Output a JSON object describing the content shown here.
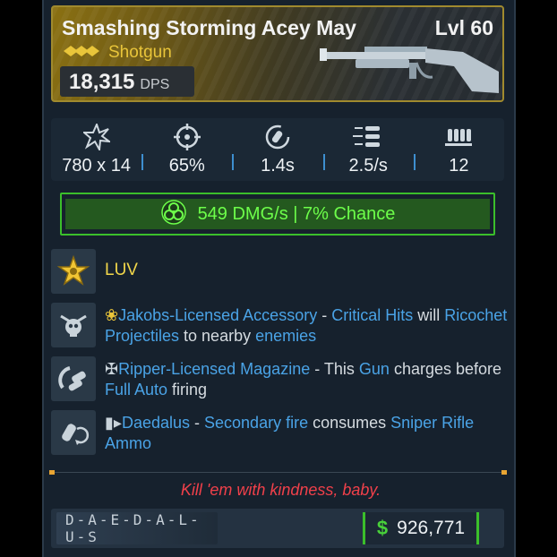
{
  "item": {
    "name": "Smashing Storming Acey May",
    "level": "Lvl 60",
    "type": "Shotgun",
    "dps": "18,315",
    "dps_unit": "DPS",
    "rarity_color": "#e9c53a"
  },
  "stats": [
    {
      "icon": "damage-burst-icon",
      "value": "780 x 14"
    },
    {
      "icon": "accuracy-crosshair-icon",
      "value": "65%"
    },
    {
      "icon": "reload-icon",
      "value": "1.4s"
    },
    {
      "icon": "fire-rate-icon",
      "value": "2.5/s"
    },
    {
      "icon": "magazine-icon",
      "value": "12"
    }
  ],
  "element": {
    "icon": "biohazard-icon",
    "text": "549 DMG/s | 7% Chance",
    "color": "#6dff4a"
  },
  "perks": {
    "luv": "LUV",
    "jakobs": {
      "lead": "Jakobs-Licensed Accessory",
      "sep": " - ",
      "p1": "Critical Hits",
      "t1": " will ",
      "p2": "Ricochet Projectiles",
      "t2": " to nearby ",
      "p3": "enemies"
    },
    "ripper": {
      "lead": "Ripper-Licensed Magazine",
      "sep": " - This ",
      "p1": "Gun",
      "t1": " charges before ",
      "p2": "Full Auto",
      "t2": " firing"
    },
    "daedalus": {
      "lead": "Daedalus",
      "sep": " - ",
      "p1": "Secondary fire",
      "t1": " consumes ",
      "p2": "Sniper Rifle Ammo"
    }
  },
  "flavor_text": "Kill 'em with kindness, baby.",
  "footer": {
    "manufacturer": "D-A-E-D-A-L-U-S",
    "currency_symbol": "$",
    "price": "926,771"
  }
}
